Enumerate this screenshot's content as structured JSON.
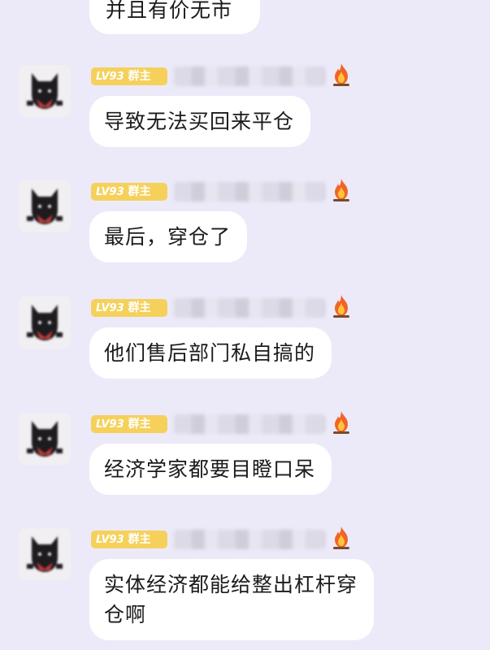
{
  "chat": {
    "top_message": {
      "text": "并且有价无市"
    },
    "messages": [
      {
        "badge_level": "LV93",
        "badge_role": "群主",
        "text": "导致无法买回来平仓"
      },
      {
        "badge_level": "LV93",
        "badge_role": "群主",
        "text": "最后，穿仓了"
      },
      {
        "badge_level": "LV93",
        "badge_role": "群主",
        "text": "他们售后部门私自搞的"
      },
      {
        "badge_level": "LV93",
        "badge_role": "群主",
        "text": "经济学家都要目瞪口呆"
      },
      {
        "badge_level": "LV93",
        "badge_role": "群主",
        "text_line1": "实体经济都能给整出杠杆穿",
        "text_line2": "仓啊"
      }
    ]
  },
  "colors": {
    "background": "#ECEAF8",
    "bubble": "#FFFFFF",
    "badge": "#F5D15C",
    "text": "#1B1B1B"
  },
  "icons": {
    "avatar": "black-cat-avatar",
    "badge_flair": "fire-icon"
  }
}
